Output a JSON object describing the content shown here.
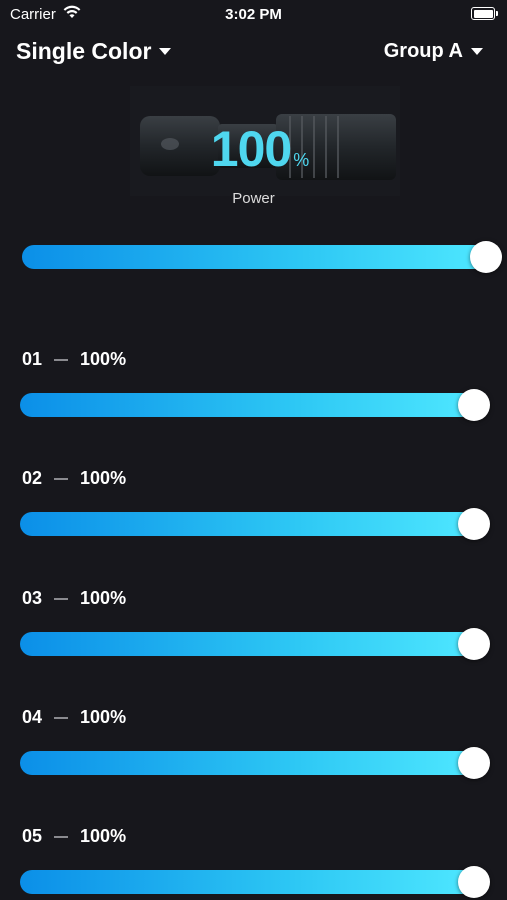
{
  "status_bar": {
    "carrier": "Carrier",
    "time": "3:02 PM",
    "wifi_icon": "wifi-icon",
    "battery_icon": "battery-icon"
  },
  "header": {
    "mode": "Single Color",
    "group": "Group A"
  },
  "power": {
    "value": "100",
    "unit": "%",
    "caption": "Power",
    "level": 1.0
  },
  "channels": [
    {
      "id": "01",
      "value": "100%",
      "level": 1.0
    },
    {
      "id": "02",
      "value": "100%",
      "level": 1.0
    },
    {
      "id": "03",
      "value": "100%",
      "level": 1.0
    },
    {
      "id": "04",
      "value": "100%",
      "level": 1.0
    },
    {
      "id": "05",
      "value": "100%",
      "level": 1.0
    }
  ],
  "colors": {
    "background": "#17171c",
    "accent": "#4fd7ef",
    "slider_start": "#0b8fe8",
    "slider_end": "#4ee7ff"
  }
}
